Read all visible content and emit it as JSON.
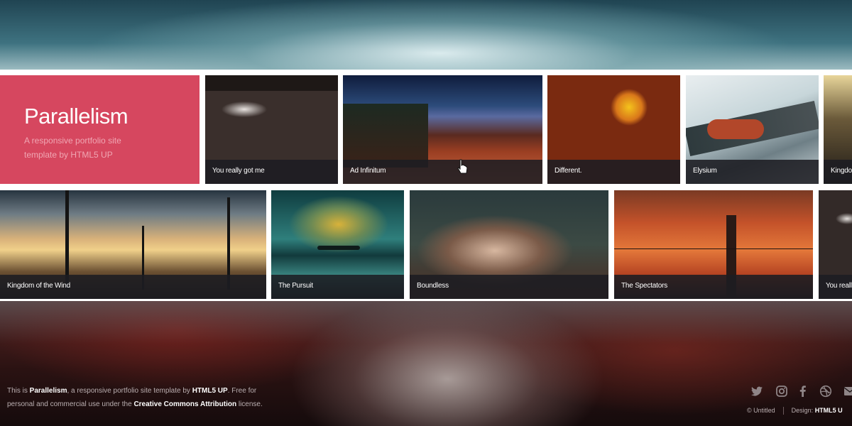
{
  "intro": {
    "title": "Parallelism",
    "subtitle": "A responsive portfolio site template by HTML5 UP"
  },
  "tiles_row1": [
    {
      "caption": "You really got me"
    },
    {
      "caption": "Ad Infinitum"
    },
    {
      "caption": "Different."
    },
    {
      "caption": "Elysium"
    },
    {
      "caption": "Kingdo"
    }
  ],
  "tiles_row2": [
    {
      "caption": "Kingdom of the Wind"
    },
    {
      "caption": "The Pursuit"
    },
    {
      "caption": "Boundless"
    },
    {
      "caption": "The Spectators"
    },
    {
      "caption": "You really"
    }
  ],
  "footer": {
    "text_1": "This is ",
    "brand": "Parallelism",
    "text_2": ", a responsive portfolio site template by ",
    "author": "HTML5 UP",
    "text_3": ". Free for personal and commercial use under the ",
    "license": "Creative Commons Attribution",
    "text_4": " license.",
    "copyright": "© Untitled",
    "design_label": "Design: ",
    "design_link": "HTML5 U"
  },
  "social_icons": [
    "twitter-icon",
    "instagram-icon",
    "facebook-icon",
    "dribbble-icon",
    "email-icon"
  ],
  "colors": {
    "accent": "#d6475f",
    "caption_bg": "#1c1c22"
  }
}
